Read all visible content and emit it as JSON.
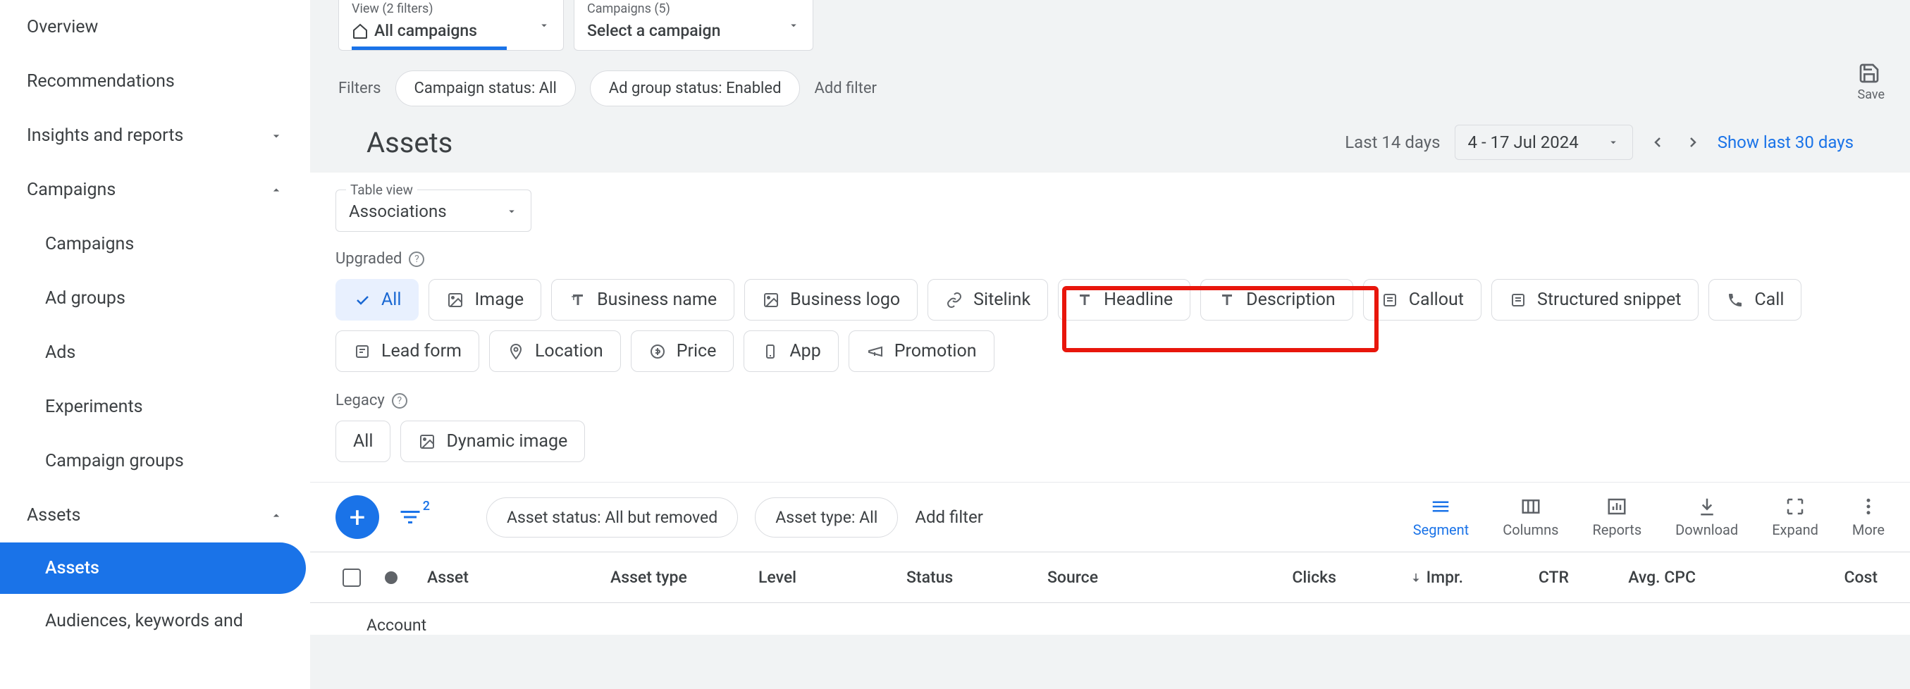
{
  "sidebar": {
    "overview": "Overview",
    "recommendations": "Recommendations",
    "insights": "Insights and reports",
    "campaigns": "Campaigns",
    "sub": {
      "campaigns": "Campaigns",
      "adgroups": "Ad groups",
      "ads": "Ads",
      "experiments": "Experiments",
      "campaign_groups": "Campaign groups"
    },
    "assets": "Assets",
    "assets_sub": "Assets",
    "audiences": "Audiences, keywords and"
  },
  "view_dropdown": {
    "label": "View (2 filters)",
    "value": "All campaigns"
  },
  "campaign_dropdown": {
    "label": "Campaigns (5)",
    "value": "Select a campaign"
  },
  "filters": {
    "label": "Filters",
    "chip1": "Campaign status: All",
    "chip2": "Ad group status: Enabled",
    "add": "Add filter"
  },
  "save": "Save",
  "page_title": "Assets",
  "date": {
    "last": "Last 14 days",
    "range": "4 - 17 Jul 2024",
    "show_last": "Show last 30 days"
  },
  "table_view": {
    "label": "Table view",
    "value": "Associations"
  },
  "upgraded_label": "Upgraded",
  "legacy_label": "Legacy",
  "chips": {
    "all": "All",
    "image": "Image",
    "business_name": "Business name",
    "business_logo": "Business logo",
    "sitelink": "Sitelink",
    "headline": "Headline",
    "description": "Description",
    "callout": "Callout",
    "structured": "Structured snippet",
    "call": "Call",
    "lead_form": "Lead form",
    "location": "Location",
    "price": "Price",
    "app": "App",
    "promotion": "Promotion"
  },
  "legacy_chips": {
    "all": "All",
    "dynamic_image": "Dynamic image"
  },
  "toolbar": {
    "filter_badge": "2",
    "pill1": "Asset status: All but removed",
    "pill2": "Asset type: All",
    "add_filter": "Add filter",
    "segment": "Segment",
    "columns": "Columns",
    "reports": "Reports",
    "download": "Download",
    "expand": "Expand",
    "more": "More"
  },
  "table": {
    "asset": "Asset",
    "asset_type": "Asset type",
    "level": "Level",
    "status": "Status",
    "source": "Source",
    "clicks": "Clicks",
    "impr": "Impr.",
    "ctr": "CTR",
    "avg_cpc": "Avg. CPC",
    "cost": "Cost"
  },
  "row_account": "Account"
}
